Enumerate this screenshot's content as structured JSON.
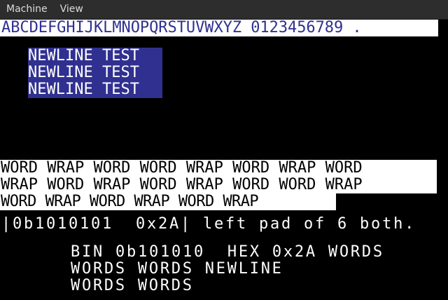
{
  "menubar": {
    "items": [
      "Machine",
      "View"
    ]
  },
  "screen": {
    "charset_line": "ABCDEFGHIJKLMNOPQRSTUVWXYZ 0123456789 .",
    "newline_lines": [
      "NEWLINE TEST",
      "NEWLINE TEST",
      "NEWLINE TEST"
    ],
    "wrap_lines": [
      "WORD WRAP WORD WORD WRAP WORD WRAP WORD",
      "WRAP WORD WRAP WORD WRAP WORD WORD WRAP",
      "WORD WRAP WORD WRAP WORD WRAP"
    ],
    "pad_line": "|0b1010101  0x2A| left pad of 6 both.",
    "words_lines": [
      "BIN 0b101010  HEX 0x2A WORDS",
      "WORDS WORDS NEWLINE",
      "WORDS WORDS"
    ]
  },
  "colors": {
    "menubar_bg": "#2d2d2d",
    "menubar_text": "#dcdcdc",
    "screen_bg": "#000000",
    "blue": "#303090",
    "white": "#ffffff"
  }
}
